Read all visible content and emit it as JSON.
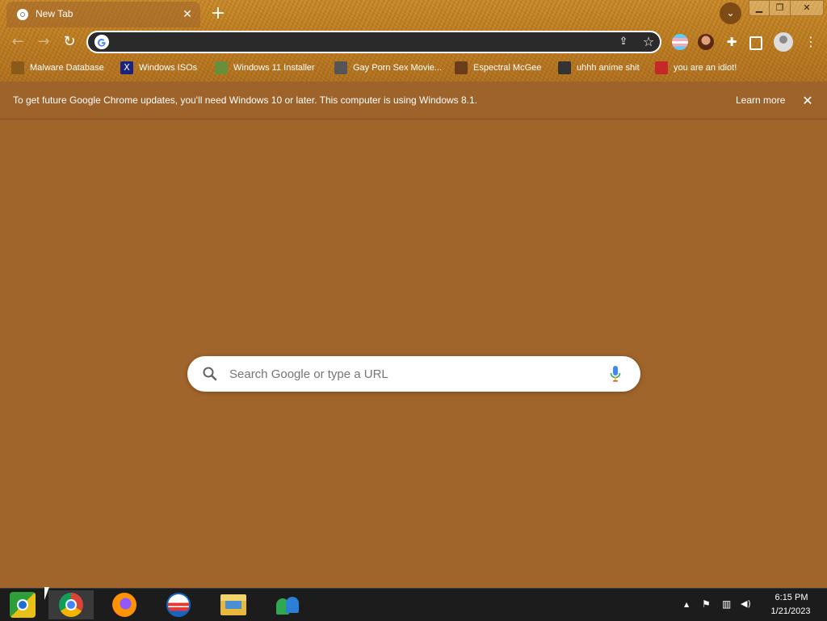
{
  "tab": {
    "title": "New Tab",
    "close_symbol": "✕"
  },
  "new_tab_symbol": "+",
  "window_controls": {
    "minimize": "▁",
    "maximize": "❐",
    "close": "✕"
  },
  "toolbar": {
    "back": "←",
    "forward": "→",
    "reload": "↻"
  },
  "bookmarks": [
    {
      "label": "Malware Database",
      "icon": "malware-database-icon",
      "color": "#8a5a1a"
    },
    {
      "label": "Windows ISOs",
      "icon": "x-icon",
      "color": "#1a237e"
    },
    {
      "label": "Windows 11 Installer",
      "icon": "installer-icon",
      "color": "#6a8f3a"
    },
    {
      "label": "Gay Porn Sex Movie...",
      "icon": "page-icon",
      "color": "#555555"
    },
    {
      "label": "Espectral McGee",
      "icon": "character-icon",
      "color": "#6b3d1a"
    },
    {
      "label": "uhhh anime shit",
      "icon": "anime-icon",
      "color": "#333333"
    },
    {
      "label": "you are an idiot!",
      "icon": "flag-icon",
      "color": "#c62828"
    }
  ],
  "infobar": {
    "message": "To get future Google Chrome updates, you'll need Windows 10 or later. This computer is using Windows 8.1.",
    "learn_more": "Learn more",
    "close_symbol": "✕"
  },
  "search": {
    "placeholder": "Search Google or type a URL"
  },
  "taskbar": {
    "time": "6:15 PM",
    "date": "1/21/2023",
    "tray_chevron": "▲",
    "tray_flag": "⚑",
    "tray_network": "▥",
    "tray_volume": "◀)"
  },
  "colors": {
    "background": "#A0652B",
    "accent_blue": "#4285F4"
  }
}
